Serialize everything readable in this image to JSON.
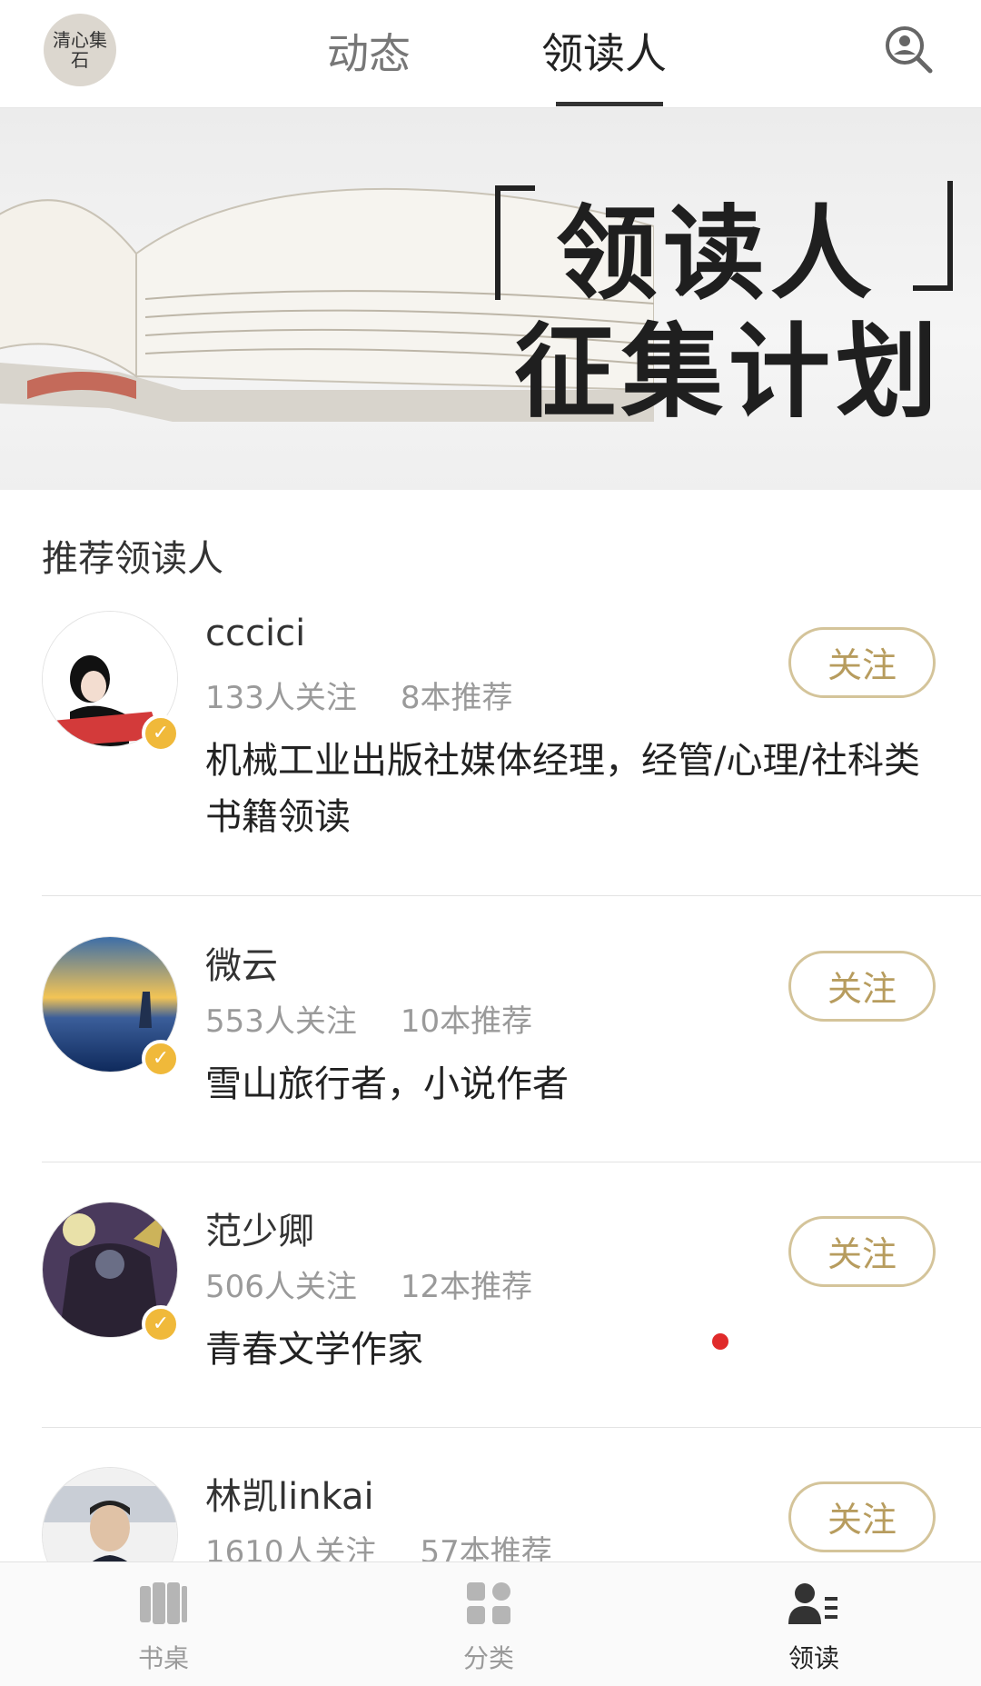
{
  "header": {
    "logo_text": "清心集石",
    "tabs": [
      {
        "label": "动态"
      },
      {
        "label": "领读人"
      }
    ],
    "search_icon": "profile-search-icon"
  },
  "banner": {
    "title_line1": "领读人",
    "title_line2": "征集计划"
  },
  "section": {
    "title": "推荐领读人"
  },
  "leaders": [
    {
      "name": "cccici",
      "followers": "133人关注",
      "recommends": "8本推荐",
      "desc": "机械工业出版社媒体经理，经管/心理/社科类书籍领读",
      "follow_label": "关注"
    },
    {
      "name": "微云",
      "followers": "553人关注",
      "recommends": "10本推荐",
      "desc": "雪山旅行者，小说作者",
      "follow_label": "关注"
    },
    {
      "name": "范少卿",
      "followers": "506人关注",
      "recommends": "12本推荐",
      "desc": "青春文学作家",
      "follow_label": "关注"
    },
    {
      "name": "林凯linkai",
      "followers": "1610人关注",
      "recommends": "57本推荐",
      "desc": "",
      "follow_label": "关注"
    }
  ],
  "bottom_nav": [
    {
      "label": "书桌",
      "icon": "bookshelf-icon"
    },
    {
      "label": "分类",
      "icon": "category-grid-icon"
    },
    {
      "label": "领读",
      "icon": "reader-list-icon"
    }
  ],
  "colors": {
    "accent_gold": "#b79c5e",
    "badge": "#f0b93a",
    "dot": "#e02a2a"
  }
}
